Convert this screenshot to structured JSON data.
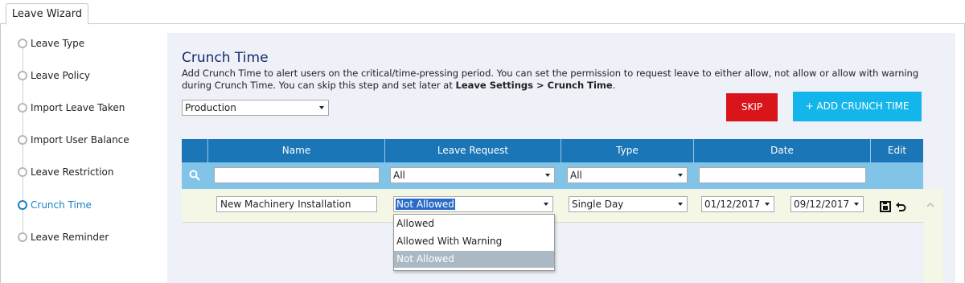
{
  "window": {
    "tab_label": "Leave Wizard"
  },
  "wizard_steps": [
    {
      "label": "Leave Type",
      "active": false
    },
    {
      "label": "Leave Policy",
      "active": false
    },
    {
      "label": "Import Leave Taken",
      "active": false
    },
    {
      "label": "Import User Balance",
      "active": false
    },
    {
      "label": "Leave Restriction",
      "active": false
    },
    {
      "label": "Crunch Time",
      "active": true
    },
    {
      "label": "Leave Reminder",
      "active": false
    }
  ],
  "page": {
    "title": "Crunch Time",
    "description": "Add Crunch Time to alert users on the critical/time-pressing period. You can set the permission to request leave to either allow, not allow or allow with warning during Crunch Time. You can skip this step and set later at",
    "description_link": "Leave Settings > Crunch Time",
    "description_end": "."
  },
  "department_select": {
    "value": "Production"
  },
  "buttons": {
    "skip": "SKIP",
    "add_crunch_time": "+ ADD CRUNCH TIME"
  },
  "table": {
    "columns": [
      "Name",
      "Leave Request",
      "Type",
      "Date",
      "Edit"
    ],
    "filters": {
      "name": "",
      "leave_request": "All",
      "type": "All",
      "date": ""
    },
    "rows": [
      {
        "name": "New Machinery Installation",
        "leave_request": "Not Allowed",
        "type": "Single Day",
        "date_from": "01/12/2017",
        "date_to": "09/12/2017"
      }
    ]
  },
  "leave_request_options": [
    "Allowed",
    "Allowed With Warning",
    "Not Allowed"
  ],
  "leave_request_selected": "Not Allowed",
  "icons": {
    "search": "search-icon",
    "save": "save-icon",
    "undo": "undo-icon",
    "scroll_up": "chevron-up-icon"
  },
  "colors": {
    "header": "#1a76b6",
    "filter_row": "#82c3e8",
    "skip": "#d9141b",
    "add": "#13b6ea",
    "active_step": "#1a7fc4"
  }
}
